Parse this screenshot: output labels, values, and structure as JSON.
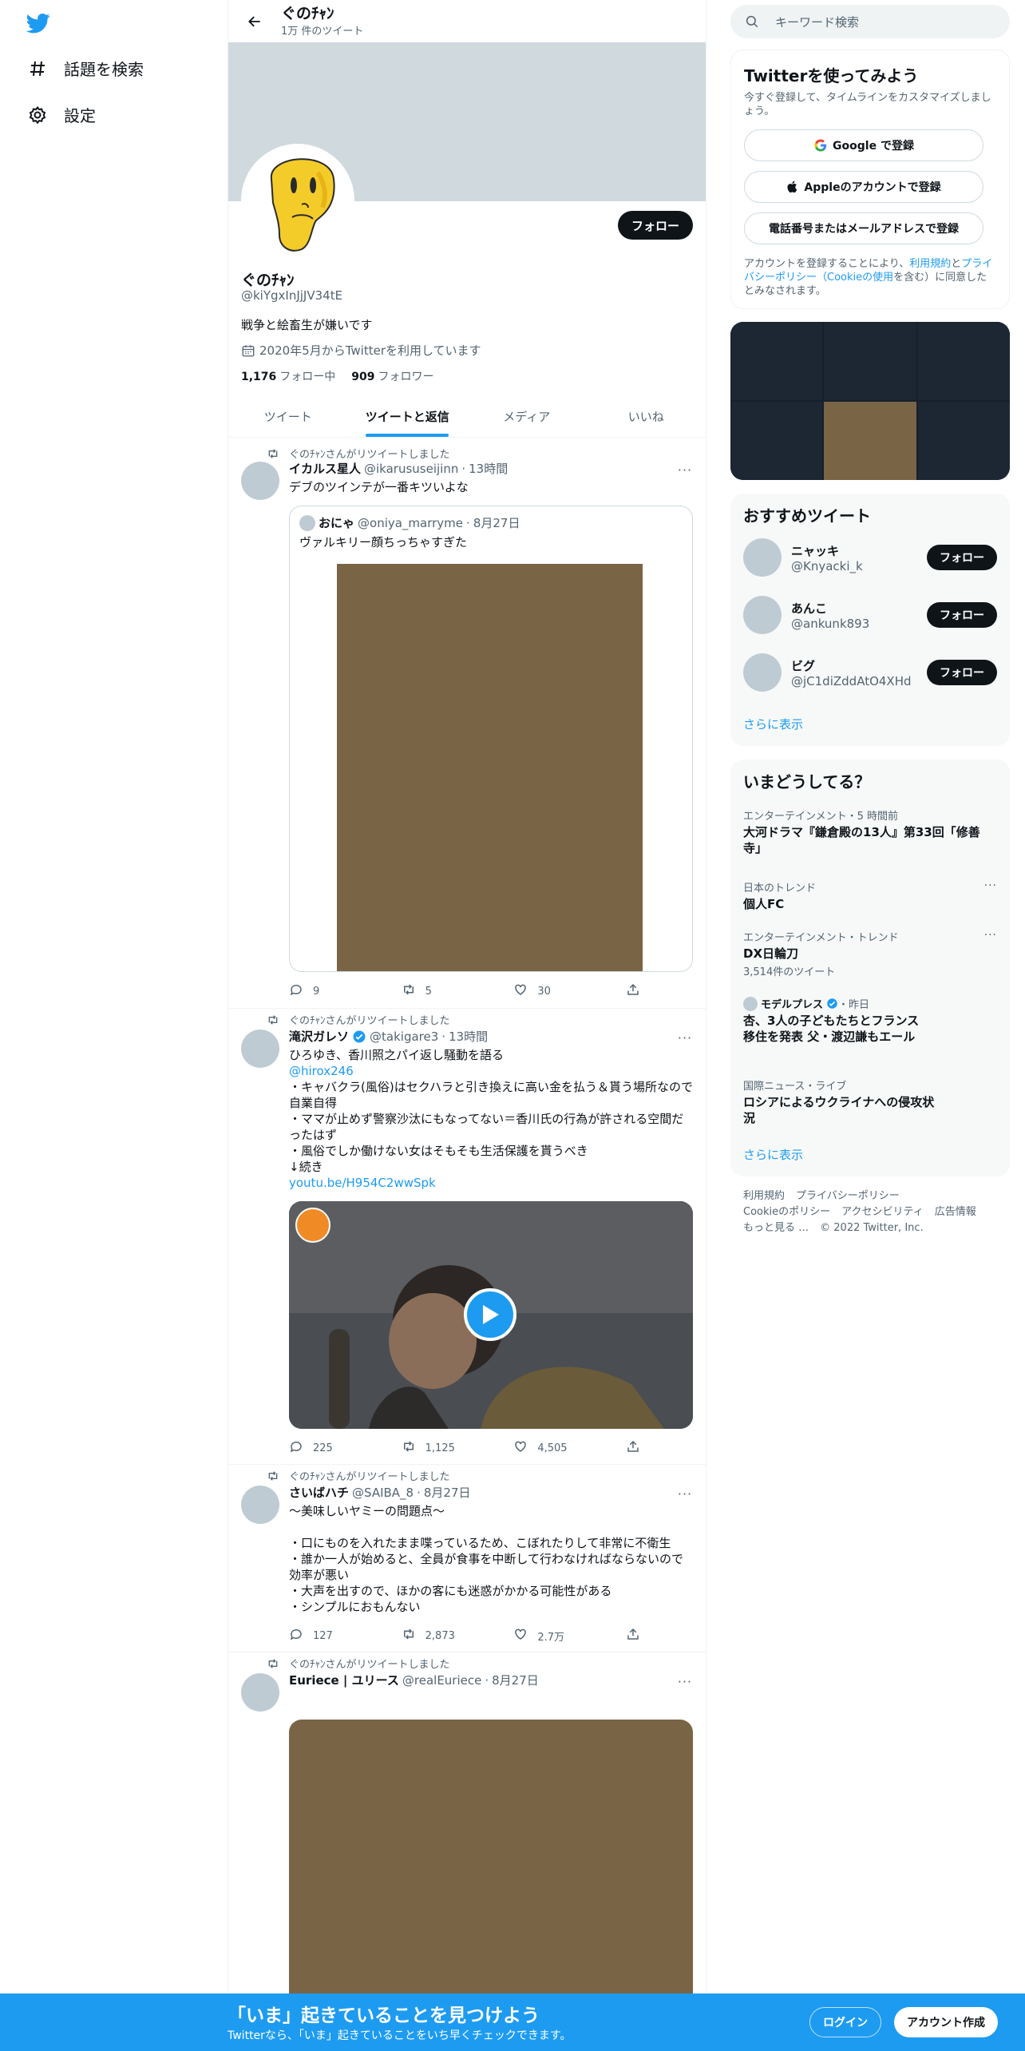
{
  "nav": {
    "items": [
      {
        "label": "話題を検索",
        "icon": "hashtag-icon"
      },
      {
        "label": "設定",
        "icon": "gear-icon"
      }
    ]
  },
  "profile": {
    "header_name": "ぐのﾁｬﾝ",
    "header_count": "1万 件のツイート",
    "follow_label": "フォロー",
    "name": "ぐのﾁｬﾝ",
    "handle": "@kiYgxInJjJV34tE",
    "bio": "戦争と絵畜生が嫌いです",
    "joined": "2020年5月からTwitterを利用しています",
    "following_count": "1,176",
    "following_label": "フォロー中",
    "followers_count": "909",
    "followers_label": "フォロワー"
  },
  "tabs": [
    {
      "label": "ツイート"
    },
    {
      "label": "ツイートと返信"
    },
    {
      "label": "メディア"
    },
    {
      "label": "いいね"
    }
  ],
  "tweets": [
    {
      "retweet_by": "ぐのﾁｬﾝさんがリツイートしました",
      "name": "イカルス星人",
      "handle": "@ikarususeijinn",
      "time": "13時間",
      "text": "デブのツインテが一番キツいよな",
      "quote": {
        "name": "おにゃ",
        "handle": "@oniya_marryme",
        "time": "8月27日",
        "text": "ヴァルキリー顔ちっちゃすぎた"
      },
      "replies": "9",
      "retweets": "5",
      "likes": "30"
    },
    {
      "retweet_by": "ぐのﾁｬﾝさんがリツイートしました",
      "name": "滝沢ガレソ",
      "handle": "@takigare3",
      "time": "13時間",
      "lines": [
        "ひろゆき、香川照之パイ返し騒動を語る",
        "@hirox246",
        "・キャバクラ(風俗)はセクハラと引き換えに高い金を払う＆貰う場所なので自業自得",
        "・ママが止めず警察沙汰にもなってない＝香川氏の行為が許される空間だったはず",
        "・風俗でしか働けない女はそもそも生活保護を貰うべき",
        "↓続き",
        "youtu.be/H954C2wwSpk"
      ],
      "replies": "225",
      "retweets": "1,125",
      "likes": "4,505"
    },
    {
      "retweet_by": "ぐのﾁｬﾝさんがリツイートしました",
      "name": "さいばハチ",
      "handle": "@SAIBA_8",
      "time": "8月27日",
      "lines": [
        "～美味しいヤミーの問題点～",
        "",
        "・口にものを入れたまま喋っているため、こぼれたりして非常に不衛生",
        "・誰か一人が始めると、全員が食事を中断して行わなければならないので効率が悪い",
        "・大声を出すので、ほかの客にも迷惑がかかる可能性がある",
        "・シンプルにおもんない"
      ],
      "replies": "127",
      "retweets": "2,873",
      "likes": "2.7万"
    },
    {
      "retweet_by": "ぐのﾁｬﾝさんがリツイートしました",
      "name": "Euriece | ユリース",
      "handle": "@realEuriece",
      "time": "8月27日"
    }
  ],
  "right": {
    "search_placeholder": "キーワード検索",
    "signup": {
      "title": "Twitterを使ってみよう",
      "subtitle": "今すぐ登録して、タイムラインをカスタマイズしましょう。",
      "google": "Google で登録",
      "apple": "Appleのアカウントで登録",
      "phone": "電話番号またはメールアドレスで登録",
      "legal_1": "アカウントを登録することにより、",
      "legal_terms": "利用規約",
      "legal_2": "と",
      "legal_privacy": "プライバシーポリシー（Cookieの使用",
      "legal_3": "を含む）に同意したとみなされます。"
    },
    "reco": {
      "title": "おすすめツイート",
      "users": [
        {
          "name": "ニャッキ",
          "handle": "@Knyacki_k"
        },
        {
          "name": "あんこ",
          "handle": "@ankunk893"
        },
        {
          "name": "ビグ",
          "handle": "@jC1diZddAtO4XHd"
        }
      ],
      "follow_label": "フォロー",
      "show_more": "さらに表示"
    },
    "trends": {
      "title": "いまどうしてる？",
      "items": [
        {
          "meta": "エンターテインメント・5 時間前",
          "title": "大河ドラマ『鎌倉殿の13人』第33回「修善寺」"
        },
        {
          "meta": "日本のトレンド",
          "title": "個人FC"
        },
        {
          "meta": "エンターテインメント・トレンド",
          "title": "DX日輪刀",
          "count": "3,514件のツイート"
        },
        {
          "meta": "モデルプレス",
          "meta_time": "・昨日",
          "title": "杏、3人の子どもたちとフランス移住を発表 父・渡辺謙もエール"
        },
        {
          "meta": "国際ニュース・ライブ",
          "title": "ロシアによるウクライナへの侵攻状況"
        }
      ],
      "show_more": "さらに表示"
    },
    "footer": [
      "利用規約",
      "プライバシーポリシー",
      "Cookieのポリシー",
      "アクセシビリティ",
      "広告情報",
      "もっと見る …",
      "© 2022 Twitter, Inc."
    ]
  },
  "bottom": {
    "title": "「いま」起きていることを見つけよう",
    "subtitle": "Twitterなら、「いま」起きていることをいち早くチェックできます。",
    "login": "ログイン",
    "signup": "アカウント作成"
  },
  "colors": {
    "accent": "#1d9bf0",
    "text": "#0f1419",
    "muted": "#536471",
    "banner": "#cfd9de",
    "media_brown": "#7a6446"
  }
}
